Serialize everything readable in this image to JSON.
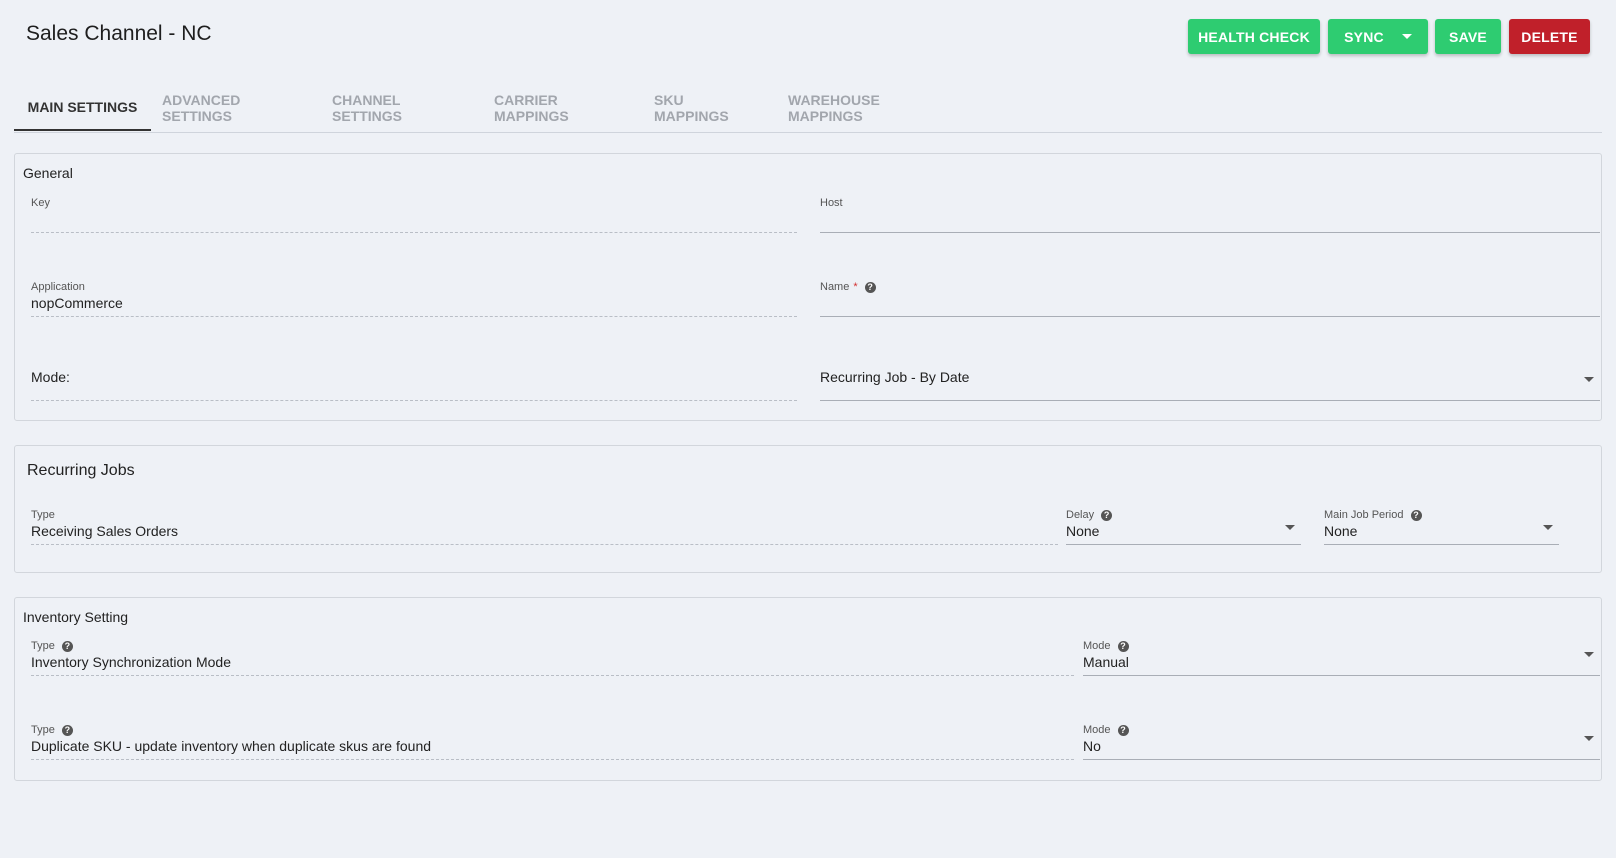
{
  "header": {
    "title": "Sales Channel - NC",
    "buttons": {
      "health_check": "HEALTH CHECK",
      "sync": "SYNC",
      "save": "SAVE",
      "delete": "DELETE"
    }
  },
  "tabs": [
    {
      "label": "MAIN SETTINGS",
      "active": true
    },
    {
      "label": "ADVANCED SETTINGS",
      "active": false
    },
    {
      "label": "CHANNEL SETTINGS",
      "active": false
    },
    {
      "label": "CARRIER MAPPINGS",
      "active": false
    },
    {
      "label": "SKU MAPPINGS",
      "active": false
    },
    {
      "label": "WAREHOUSE MAPPINGS",
      "active": false
    }
  ],
  "general": {
    "title": "General",
    "key": {
      "label": "Key",
      "value": ""
    },
    "host": {
      "label": "Host",
      "value": ""
    },
    "application": {
      "label": "Application",
      "value": "nopCommerce"
    },
    "name": {
      "label": "Name",
      "required_mark": "*",
      "value": ""
    },
    "mode": {
      "label": "Mode:",
      "value": "Recurring Job - By Date"
    }
  },
  "recurring_jobs": {
    "title": "Recurring Jobs",
    "type": {
      "label": "Type",
      "value": "Receiving Sales Orders"
    },
    "delay": {
      "label": "Delay",
      "value": "None"
    },
    "main_job_period": {
      "label": "Main Job Period",
      "value": "None"
    }
  },
  "inventory": {
    "title": "Inventory Setting",
    "rows": [
      {
        "type_label": "Type",
        "type_value": "Inventory Synchronization Mode",
        "mode_label": "Mode",
        "mode_value": "Manual"
      },
      {
        "type_label": "Type",
        "type_value": "Duplicate SKU - update inventory when duplicate skus are found",
        "mode_label": "Mode",
        "mode_value": "No"
      }
    ]
  },
  "colors": {
    "background": "#eef1f6",
    "green": "#2ecc71",
    "red": "#c0202a",
    "required": "#d32f2f"
  },
  "icons": {
    "help": "help-circle-icon",
    "dropdown": "caret-down-icon"
  }
}
